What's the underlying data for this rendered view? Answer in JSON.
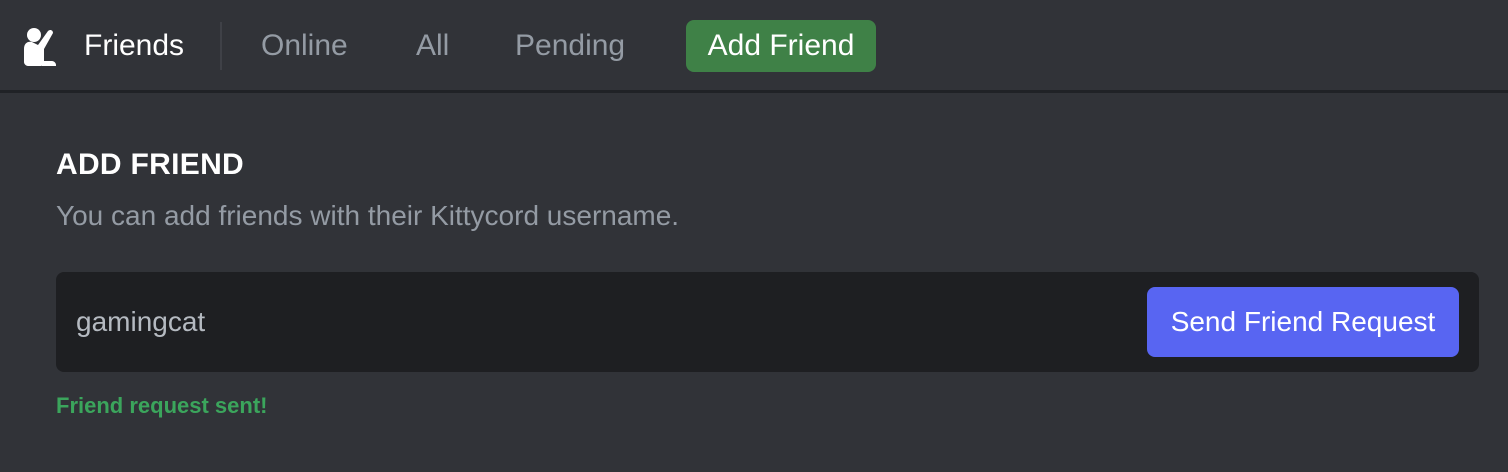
{
  "header": {
    "icon": "friends-waving-icon",
    "title": "Friends",
    "tabs": [
      {
        "label": "Online",
        "active": false
      },
      {
        "label": "All",
        "active": false
      },
      {
        "label": "Pending",
        "active": false
      },
      {
        "label": "Add Friend",
        "active": true
      }
    ]
  },
  "add_friend": {
    "title": "ADD FRIEND",
    "description": "You can add friends with their Kittycord username.",
    "input_value": "gamingcat",
    "button_label": "Send Friend Request",
    "status_message": "Friend request sent!"
  },
  "colors": {
    "background": "#313338",
    "input_background": "#1e1f22",
    "add_friend_tab": "#3f8147",
    "send_button": "#5865f2",
    "success_text": "#3ba55c",
    "muted_text": "#949ba4"
  }
}
